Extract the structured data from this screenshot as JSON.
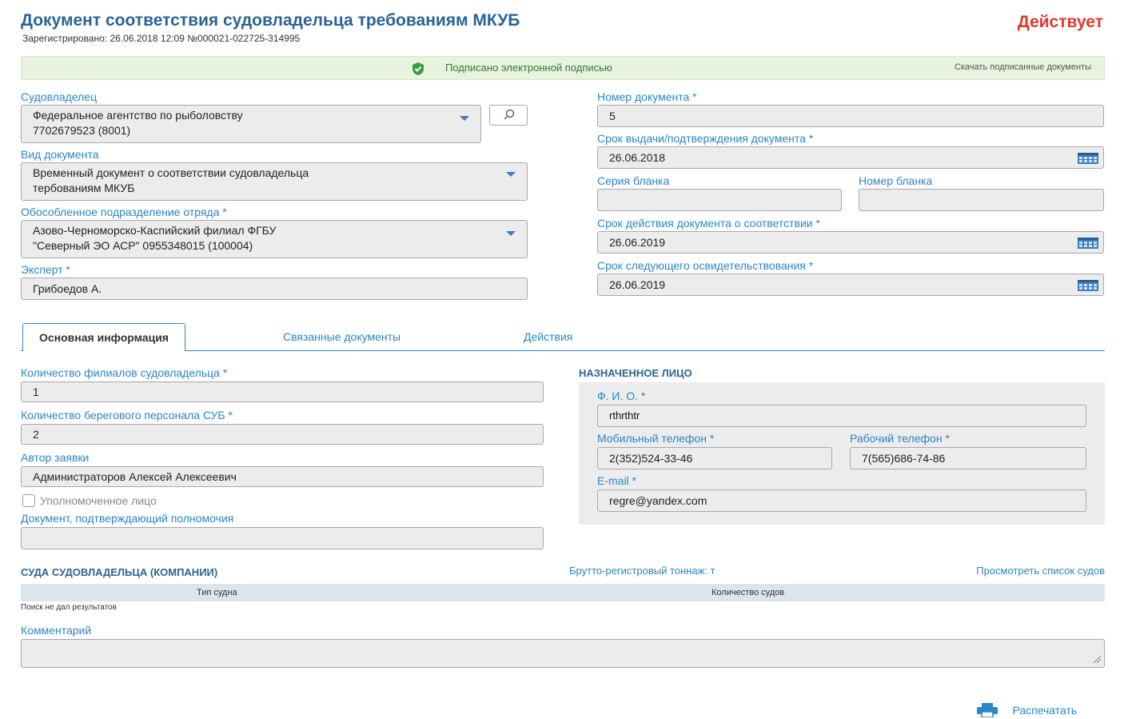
{
  "header": {
    "title": "Документ соответствия судовладельца требованиям МКУБ",
    "registered": "Зарегистрировано: 26.06.2018 12:09 №000021-022725-314995",
    "status": "Действует"
  },
  "signature": {
    "text": "Подписано электронной подписью",
    "download_link": "Скачать подписанные документы"
  },
  "left_fields": {
    "owner_label": "Судовладелец",
    "owner_line1": "Федеральное агентство по рыболовству",
    "owner_line2": "7702679523 (8001)",
    "doc_type_label": "Вид документа",
    "doc_type_line1": "Временный документ о соответствии судовладельца",
    "doc_type_line2": "тербованиям МКУБ",
    "division_label": "Обособленное подразделение отряда *",
    "division_line1": "Азово-Черноморско-Каспийский филиал ФГБУ",
    "division_line2": "\"Северный ЭО АСР\" 0955348015 (100004)",
    "expert_label": "Эксперт *",
    "expert_value": "Грибоедов А."
  },
  "right_fields": {
    "doc_number_label": "Номер документа *",
    "doc_number_value": "5",
    "issue_date_label": "Срок выдачи/подтверждения документа *",
    "issue_date_value": "26.06.2018",
    "blank_series_label": "Серия бланка",
    "blank_series_value": "",
    "blank_number_label": "Номер бланка",
    "blank_number_value": "",
    "validity_label": "Срок действия документа о соответствии *",
    "validity_value": "26.06.2019",
    "next_survey_label": "Срок следующего освидетельствования *",
    "next_survey_value": "26.06.2019"
  },
  "tabs": [
    {
      "label": "Основная информация",
      "active": true
    },
    {
      "label": "Связанные документы",
      "active": false
    },
    {
      "label": "Действия",
      "active": false
    }
  ],
  "main_info": {
    "branches_label": "Количество филиалов судовладельца *",
    "branches_value": "1",
    "shore_staff_label": "Количество берегового персонала СУБ *",
    "shore_staff_value": "2",
    "author_label": "Автор заявки",
    "author_value": "Администраторов Алексей Алексеевич",
    "authorized_label": "Уполномоченное лицо",
    "authorized_checked": false,
    "authority_doc_label": "Документ, подтверждающий полномочия",
    "authority_doc_value": ""
  },
  "designated_person": {
    "heading": "НАЗНАЧЕННОЕ ЛИЦО",
    "fio_label": "Ф. И. О. *",
    "fio_value": "rthrthtr",
    "mobile_label": "Мобильный телефон *",
    "mobile_value": "2(352)524-33-46",
    "work_label": "Рабочий телефон *",
    "work_value": "7(565)686-74-86",
    "email_label": "E-mail *",
    "email_value": "regre@yandex.com"
  },
  "vessels": {
    "heading": "СУДА СУДОВЛАДЕЛЬЦА (КОМПАНИИ)",
    "tonnage": "Брутто-регистровый тоннаж:  т",
    "view_list_link": "Просмотреть список судов",
    "columns": [
      "Тип судна",
      "Количество судов"
    ],
    "empty_text": "Поиск не дал результатов"
  },
  "comment": {
    "label": "Комментарий",
    "value": ""
  },
  "footer": {
    "print_label": "Распечатать"
  },
  "colors": {
    "accent": "#2a86c8",
    "title": "#2a6496",
    "status": "#e03a2f",
    "signed_bg": "#e7f2df"
  }
}
